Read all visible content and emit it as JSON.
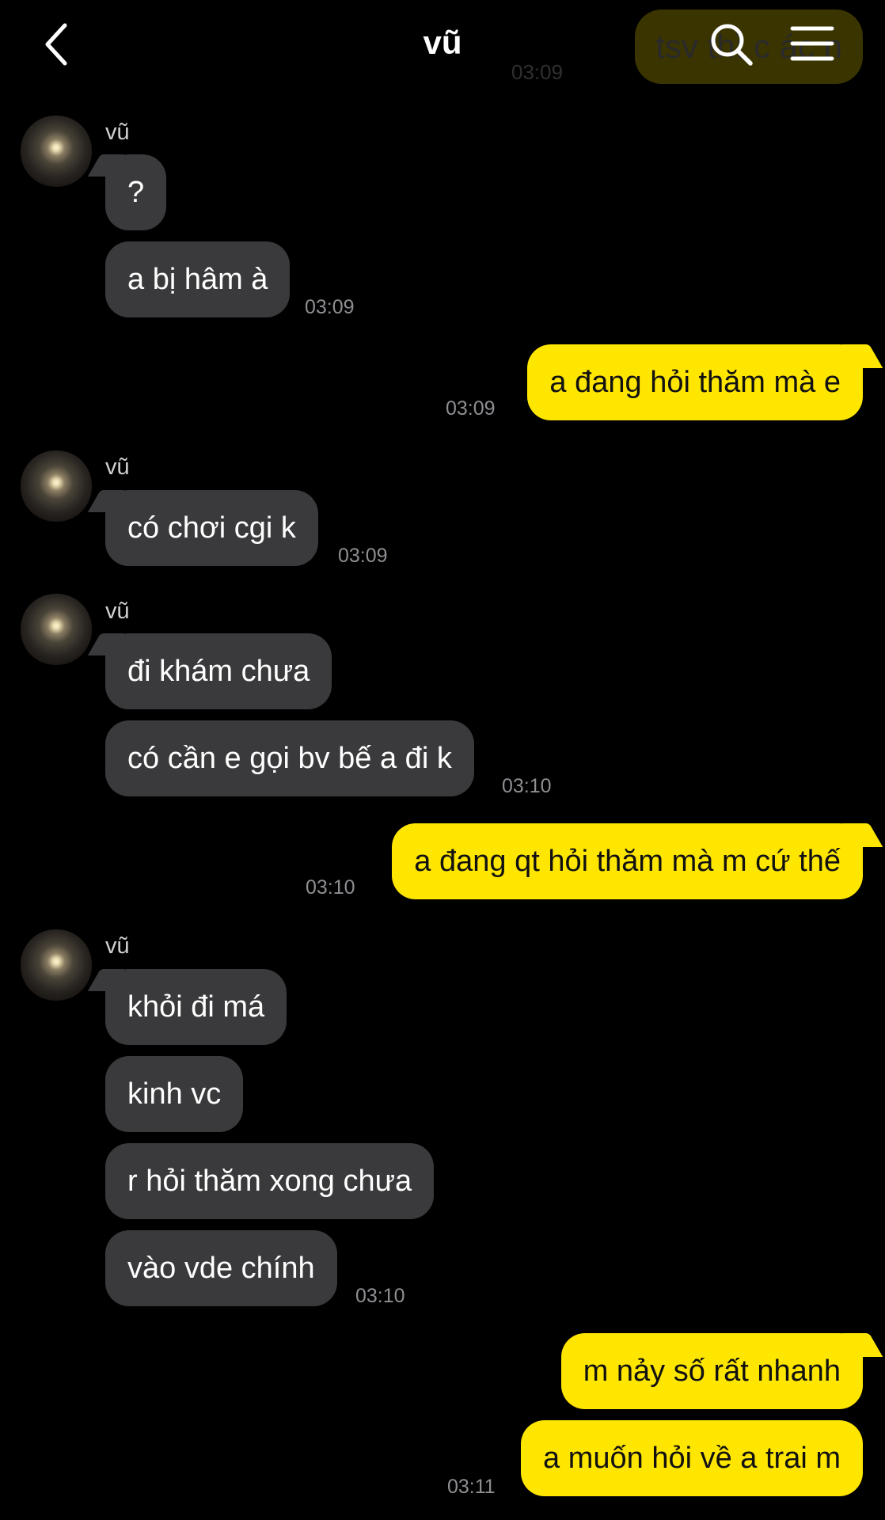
{
  "header": {
    "title": "vũ",
    "back_icon": "chevron-left-icon",
    "search_icon": "search-icon",
    "menu_icon": "menu-icon"
  },
  "ghost": {
    "text": "tsv thì c  ác n  ",
    "time": "03:09"
  },
  "contact": {
    "name": "vũ"
  },
  "colors": {
    "background": "#000000",
    "incoming_bubble": "#3a3a3c",
    "outgoing_bubble": "#ffe600",
    "timestamp": "#8e8e93"
  },
  "messages": [
    {
      "dir": "in",
      "text": "?"
    },
    {
      "dir": "in",
      "text": "a bị hâm à",
      "time": "03:09"
    },
    {
      "dir": "out",
      "text": "a đang hỏi thăm mà e",
      "time": "03:09"
    },
    {
      "dir": "in",
      "text": "có chơi cgi k",
      "time": "03:09"
    },
    {
      "dir": "in",
      "text": "đi khám chưa"
    },
    {
      "dir": "in",
      "text": "có cần e gọi bv bế a đi k",
      "time": "03:10"
    },
    {
      "dir": "out",
      "text": "a đang qt hỏi thăm mà m cứ thế",
      "time": "03:10"
    },
    {
      "dir": "in",
      "text": "khỏi đi má"
    },
    {
      "dir": "in",
      "text": "kinh vc"
    },
    {
      "dir": "in",
      "text": "r hỏi thăm xong chưa"
    },
    {
      "dir": "in",
      "text": "vào vde chính",
      "time": "03:10"
    },
    {
      "dir": "out",
      "text": "m nảy số rất nhanh"
    },
    {
      "dir": "out",
      "text": "a muốn hỏi về a trai m",
      "time": "03:11"
    }
  ]
}
